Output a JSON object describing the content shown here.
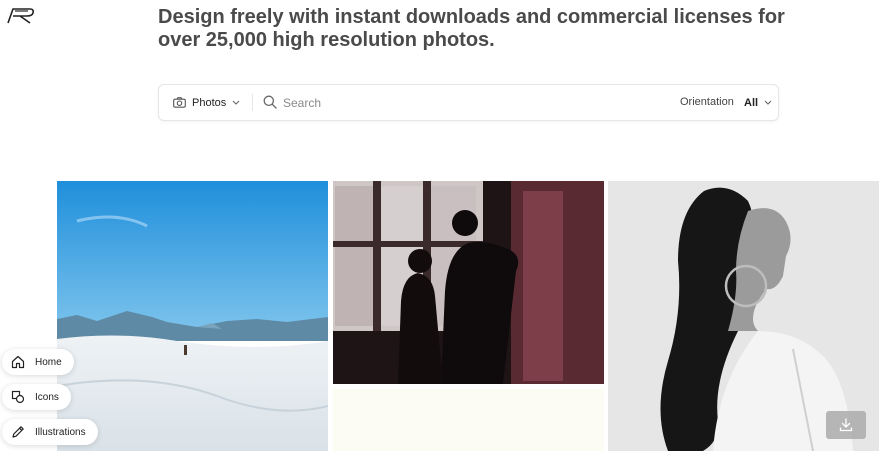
{
  "headline": "Design freely with instant downloads and commercial licenses for over 25,000 high resolution photos.",
  "search": {
    "type_label": "Photos",
    "placeholder": "Search",
    "orientation_label": "Orientation",
    "orientation_value": "All"
  },
  "nav": {
    "home": "Home",
    "icons": "Icons",
    "illustrations": "Illustrations"
  },
  "icons": {
    "logo": "brand-logo",
    "camera": "camera-icon",
    "chevron": "chevron-down-icon",
    "search": "search-icon",
    "download": "download-icon"
  }
}
